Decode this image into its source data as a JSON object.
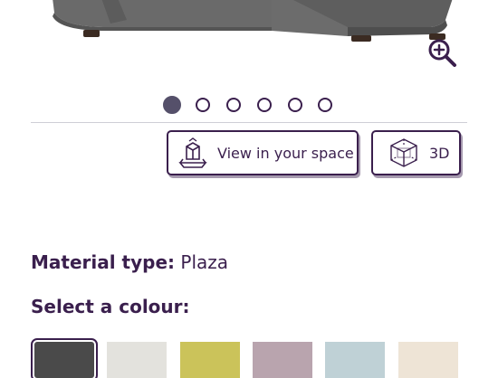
{
  "product": {
    "image_alt": "Grey corner sofa"
  },
  "gallery": {
    "slide_count": 6,
    "active_slide": 1
  },
  "actions": {
    "view_in_space_label": "View in your space",
    "three_d_label": "3D"
  },
  "material": {
    "label": "Material type:",
    "value": "Plaza"
  },
  "colour": {
    "heading": "Select a colour:",
    "swatches": [
      {
        "color": "#4a4a4a",
        "selected": true
      },
      {
        "color": "#e3e2dd",
        "selected": false
      },
      {
        "color": "#cbc35a",
        "selected": false
      },
      {
        "color": "#b9a4ae",
        "selected": false
      },
      {
        "color": "#bfd1d6",
        "selected": false
      },
      {
        "color": "#eee4d6",
        "selected": false
      }
    ]
  },
  "theme": {
    "accent": "#3a1f4d",
    "dot_active": "#55506a"
  }
}
